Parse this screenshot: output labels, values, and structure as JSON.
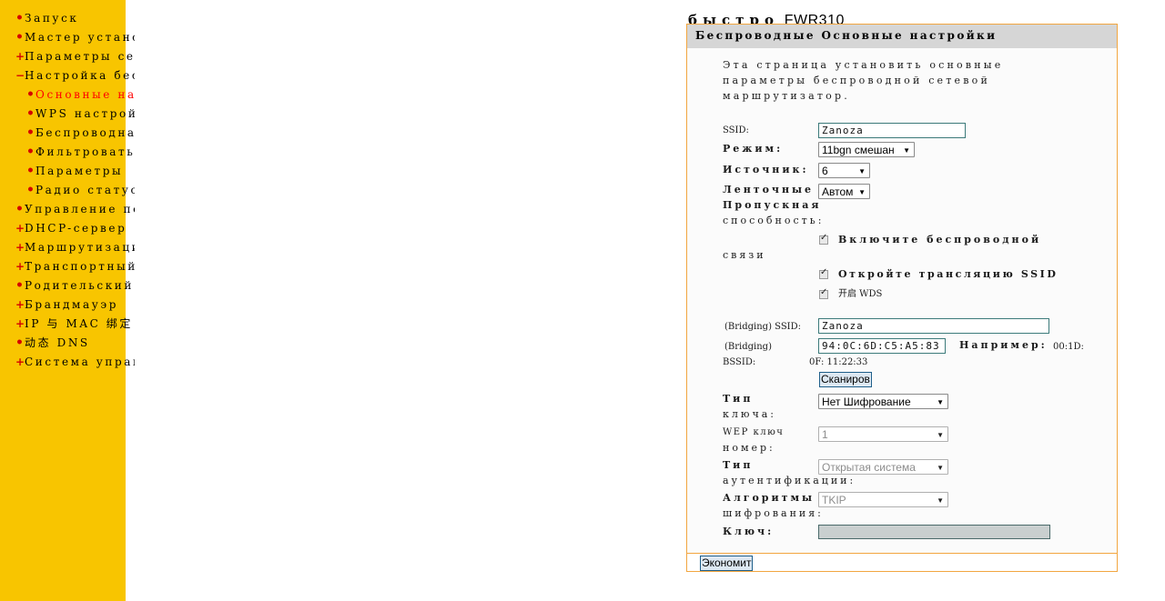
{
  "sidebar": {
    "items": [
      {
        "marker": "•",
        "label": "Запуск",
        "sub": false,
        "active": false
      },
      {
        "marker": "•",
        "label": "Мастер установки",
        "sub": false,
        "active": false
      },
      {
        "marker": "+",
        "label": "Параметры сети",
        "sub": false,
        "active": false
      },
      {
        "marker": "−",
        "label": "Настройка беспроводной сети",
        "sub": false,
        "active": false
      },
      {
        "marker": "•",
        "label": "Основные настройки",
        "sub": true,
        "active": true
      },
      {
        "marker": "•",
        "label": "WPS настройки",
        "sub": true,
        "active": false
      },
      {
        "marker": "•",
        "label": "Беспроводная безопасность",
        "sub": true,
        "active": false
      },
      {
        "marker": "•",
        "label": "Фильтровать MAC",
        "sub": true,
        "active": false
      },
      {
        "marker": "•",
        "label": "Параметры",
        "sub": true,
        "active": false
      },
      {
        "marker": "•",
        "label": "Радио статус",
        "sub": true,
        "active": false
      },
      {
        "marker": "•",
        "label": "Управление полосой",
        "sub": false,
        "active": false
      },
      {
        "marker": "+",
        "label": "DHCP-сервер",
        "sub": false,
        "active": false
      },
      {
        "marker": "+",
        "label": "Маршрутизация",
        "sub": false,
        "active": false
      },
      {
        "marker": "+",
        "label": "Транспортный поток",
        "sub": false,
        "active": false
      },
      {
        "marker": "•",
        "label": "Родительский контроль",
        "sub": false,
        "active": false
      },
      {
        "marker": "+",
        "label": "Брандмауэр",
        "sub": false,
        "active": false
      },
      {
        "marker": "+",
        "label": "IP 与 MAC 绑定",
        "sub": false,
        "active": false
      },
      {
        "marker": "•",
        "label": "动态 DNS",
        "sub": false,
        "active": false
      },
      {
        "marker": "+",
        "label": "Система управления",
        "sub": false,
        "active": false
      }
    ]
  },
  "title": {
    "part1": "быстро",
    "part2": "FWR310"
  },
  "panel": {
    "header": "Беспроводные Основные настройки",
    "intro": [
      "Эта страница установить основные",
      "параметры беспроводной сетевой",
      "маршрутизатор."
    ],
    "ssid_label": "SSID:",
    "ssid_value": "Zanoza",
    "mode_label": "Режим:",
    "mode_value": "11bgn смешан",
    "channel_label": "Источник:",
    "channel_value": "6",
    "bandwidth_label": [
      "Ленточные",
      "Пропускная",
      "способность:"
    ],
    "bandwidth_value": "Автом",
    "enable_wireless_label": "Включите беспроводной",
    "enable_wireless_label2": "связи",
    "broadcast_ssid_label": "Откройте трансляцию SSID",
    "wds_label": "开启 WDS",
    "bridge_ssid_label": "(Bridging) SSID:",
    "bridge_ssid_value": "Zanoza",
    "bridge_bssid_label1": "(Bridging)",
    "bridge_bssid_label2": "BSSID:",
    "bridge_bssid_value": "94:0C:6D:C5:A5:83",
    "example_label": "Например:",
    "example_value1": "00:1D:",
    "example_value2": "0F: 11:22:33",
    "scan_button": "Сканиров",
    "key_type_label": [
      "Тип",
      "ключа:"
    ],
    "key_type_value": "Нет Шифрование",
    "wep_key_label": [
      "WEP ключ",
      "номер:"
    ],
    "wep_key_value": "1",
    "auth_type_label": [
      "Тип",
      "аутентификации:"
    ],
    "auth_type_value": "Открытая система",
    "cipher_label": [
      "Алгоритмы",
      "шифрования:"
    ],
    "cipher_value": "TKIP",
    "key_label": "Ключ:",
    "save_button": "Экономит"
  }
}
